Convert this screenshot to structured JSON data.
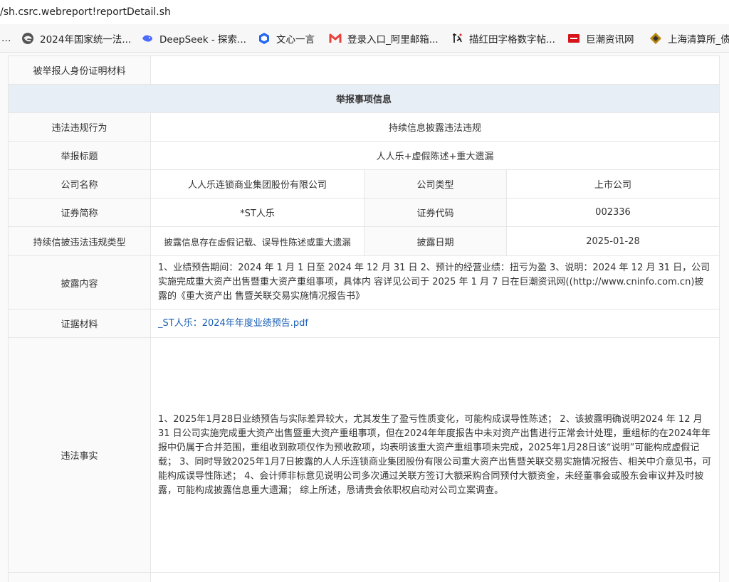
{
  "browser": {
    "url": "/sh.csrc.webreport!reportDetail.sh",
    "bookmarks": [
      {
        "label": "…",
        "icon": "ellipsis"
      },
      {
        "label": "2024年国家统一法...",
        "icon": "edge-logo-icon"
      },
      {
        "label": "DeepSeek - 探索...",
        "icon": "deepseek-whale-icon"
      },
      {
        "label": "文心一言",
        "icon": "wenxin-cube-icon"
      },
      {
        "label": "登录入口_阿里邮箱...",
        "icon": "aliyun-mail-m-icon"
      },
      {
        "label": "描红田字格数字帖...",
        "icon": "calligraphy-icon"
      },
      {
        "label": "巨潮资讯网",
        "icon": "cninfo-logo-icon"
      },
      {
        "label": "上海清算所_债",
        "icon": "shclearing-logo-icon"
      }
    ]
  },
  "report": {
    "whistleblower_id_label": "被举报人身份证明材料",
    "whistleblower_id_value": "",
    "section_title": "举报事项信息",
    "violation_label": "违法违规行为",
    "violation_value": "持续信息披露违法违规",
    "title_label": "举报标题",
    "title_value": "人人乐+虚假陈述+重大遗漏",
    "company_name_label": "公司名称",
    "company_name_value": "人人乐连锁商业集团股份有限公司",
    "company_type_label": "公司类型",
    "company_type_value": "上市公司",
    "sec_abbr_label": "证券简称",
    "sec_abbr_value": "*ST人乐",
    "sec_code_label": "证券代码",
    "sec_code_value": "002336",
    "disclosure_type_label": "持续信披违法违规类型",
    "disclosure_type_value": "披露信息存在虚假记载、误导性陈述或重大遗漏",
    "disclosure_date_label": "披露日期",
    "disclosure_date_value": "2025-01-28",
    "disclosure_content_label": "披露内容",
    "disclosure_content_value": "1、业绩预告期间：2024 年 1 月 1 日至 2024 年 12 月 31 日 2、预计的经营业绩：扭亏为盈 3、说明：2024 年 12 月 31 日，公司实施完成重大资产出售暨重大资产重组事项，具体内 容详见公司于 2025 年 1 月 7 日在巨潮资讯网((http://www.cninfo.com.cn)披露的《重大资产出 售暨关联交易实施情况报告书》",
    "evidence_label": "证据材料",
    "evidence_file": "_ST人乐：2024年年度业绩预告.pdf",
    "facts_label": "违法事实",
    "facts_value": "1、2025年1月28日业绩预告与实际差异较大，尤其发生了盈亏性质变化，可能构成误导性陈述；  2、该披露明确说明2024 年 12 月 31 日公司实施完成重大资产出售暨重大资产重组事项，但在2024年年度报告中未对资产出售进行正常会计处理，重组标的在2024年年报中仍属于合并范围，重组收到款项仅作为预收款项，均表明该重大资产重组事项未完成，2025年1月28日该“说明”可能构成虚假记载；  3、同时导致2025年1月7日披露的人人乐连锁商业集团股份有限公司重大资产出售暨关联交易实施情况报告、相关中介意见书，可能构成误导性陈述；  4、会计师非标意见说明公司多次通过关联方签订大额采购合同预付大额资金，未经董事会或股东会审议并及时披露，可能构成披露信息重大遗漏；  综上所述，恳请贵会依职权启动对公司立案调查。"
  }
}
